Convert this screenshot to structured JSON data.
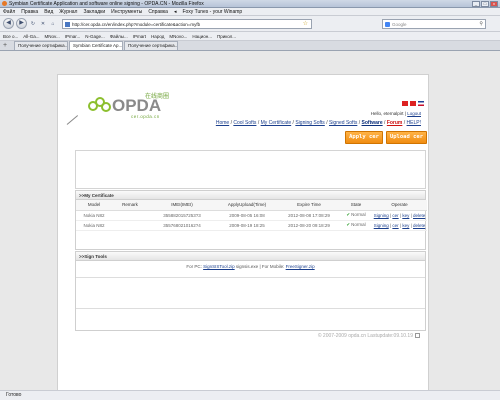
{
  "window": {
    "title": "Symbian Certificate Application and software online signing - OPDA.CN - Mozilla Firefox",
    "buttons": [
      "_",
      "□",
      "x"
    ]
  },
  "menubar": [
    "Файл",
    "Правка",
    "Вид",
    "Журнал",
    "Закладки",
    "Инструменты",
    "Справка",
    "◂",
    "Foxy Tunes - your Winamp"
  ],
  "navbar": {
    "url": "http://cer.opda.cn/en/index.php?module=certificate&action=myfb",
    "search_placeholder": "Google"
  },
  "bookmarks": [
    "Все о...",
    "All-Ga...",
    "MNov...",
    "IPmar...",
    "N-Gage...",
    "Файлы...",
    "IPmart",
    "Народ",
    "MNovo...",
    "Национ...",
    "Прикол..."
  ],
  "tabs": [
    {
      "label": "Получение сертифика..."
    },
    {
      "label": "Symbian Certificate Ap..."
    },
    {
      "label": "Получение сертифика..."
    }
  ],
  "site": {
    "logo_brand": "OPDA",
    "logo_cn": "在线商圈",
    "logo_sub": "cer.opda.cn",
    "user_greeting": "Hello, eternalpirt",
    "logout": "Logout",
    "nav": {
      "home": "Home",
      "cool_softs": "Cool Softs",
      "my_certificate": "My Certificate",
      "signing_softs": "Signing Softs",
      "signed_softs": "Signed Softs",
      "software": "Software",
      "forum": "Forum",
      "help": "HELP!"
    },
    "apply_button": "Apply cer",
    "upload_button": "Upload cer",
    "cert_section_title": ">>My Certificate",
    "cert_columns": [
      "Model",
      "Remark",
      "IMEI(IMEI)",
      "ApplyUpload(Time)",
      "Expire Time",
      "State",
      "Operate"
    ],
    "cert_rows": [
      {
        "model": "Nokia N82",
        "remark": "",
        "imei": "3558820157253?3",
        "apply": "2009-08-05 16:08",
        "expire": "2012-08-08 17:08:29",
        "state": "Normal",
        "ops": [
          "Signing",
          "cer",
          "key",
          "delete"
        ]
      },
      {
        "model": "Nokia N82",
        "remark": "",
        "imei": "3557680210162?4",
        "apply": "2009-08-19 18:25",
        "expire": "2012-08-20 09:18:29",
        "state": "Normal",
        "ops": [
          "Signing",
          "cer",
          "key",
          "delete"
        ]
      }
    ],
    "tools_section_title": ">>Sign Tools",
    "tools": {
      "pc_label": "For PC:",
      "pc_tool": "SignSISTool.zip",
      "pc_sep": " signsis.exe",
      "mobile_label": "For Mobile:",
      "mobile_tool": "FreeSigner.zip"
    },
    "copyright": "© 2007-2009 opda.cn Lastupdate:09.10.19"
  },
  "status": "Готово",
  "colors": {
    "accent_orange": "#f08c11",
    "logo_green": "#8cbf2e",
    "link_blue": "#1a3e8c",
    "forum_red": "#cc1111"
  }
}
